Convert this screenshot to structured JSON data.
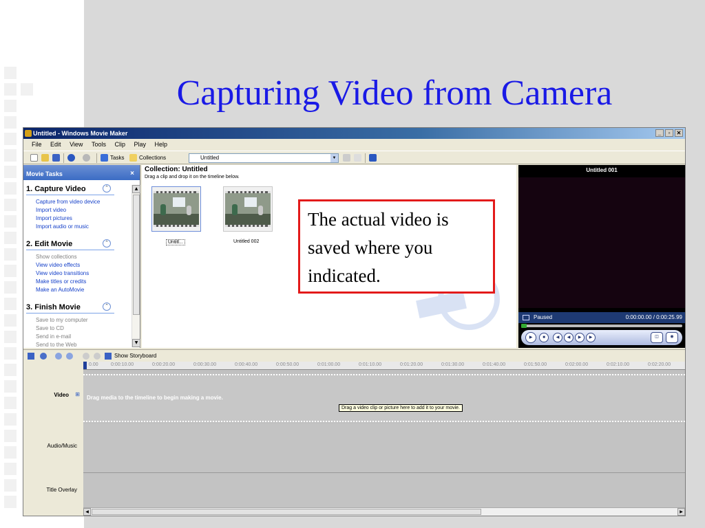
{
  "slide": {
    "title": "Capturing Video from Camera"
  },
  "window": {
    "title": "Untitled - Windows Movie Maker",
    "buttons": [
      "_",
      "▫",
      "✕"
    ]
  },
  "menu": [
    "File",
    "Edit",
    "View",
    "Tools",
    "Clip",
    "Play",
    "Help"
  ],
  "toolbar": {
    "tasks_label": "Tasks",
    "collections_label": "Collections",
    "collection_combo_value": "Untitled"
  },
  "tasks_pane": {
    "header": "Movie Tasks",
    "close": "×",
    "sections": [
      {
        "title": "1. Capture Video",
        "links": [
          "Capture from video device",
          "Import video",
          "Import pictures",
          "Import audio or music"
        ],
        "muted": false
      },
      {
        "title": "2. Edit Movie",
        "links": [
          "Show collections",
          "View video effects",
          "View video transitions",
          "Make titles or credits",
          "Make an AutoMovie"
        ],
        "muted_first": true
      },
      {
        "title": "3. Finish Movie",
        "links": [
          "Save to my computer",
          "Save to CD",
          "Send in e-mail",
          "Send to the Web"
        ],
        "muted": true
      }
    ]
  },
  "collection": {
    "title": "Collection: Untitled",
    "subtitle": "Drag a clip and drop it on the timeline below.",
    "clips": [
      {
        "label": "Untitl...",
        "selected": true
      },
      {
        "label": "Untitled 002",
        "selected": false
      }
    ]
  },
  "monitor": {
    "title": "Untitled 001",
    "state": "Paused",
    "time": "0:00:00.00 / 0:00:25.99"
  },
  "timeline_toolbar": {
    "show_storyboard": "Show Storyboard"
  },
  "timeline": {
    "ticks": [
      "0.00",
      "0:00:10.00",
      "0:00:20.00",
      "0:00:30.00",
      "0:00:40.00",
      "0:00:50.00",
      "0:01:00.00",
      "0:01:10.00",
      "0:01:20.00",
      "0:01:30.00",
      "0:01:40.00",
      "0:01:50.00",
      "0:02:00.00",
      "0:02:10.00",
      "0:02:20.00"
    ],
    "tracks": {
      "video": "Video",
      "video_expand": "⊞",
      "audio": "Audio/Music",
      "title_overlay": "Title Overlay"
    },
    "drag_hint": "Drag media to the timeline to begin making a movie.",
    "tooltip": "Drag a video clip or picture here to add it to your movie."
  },
  "callout": {
    "text": "The actual video is saved where you indicated."
  },
  "colors": {
    "title_blue": "#1a1ae6",
    "callout_border": "#e31a1a",
    "titlebar_start": "#0a246a",
    "link_blue": "#1540c9"
  }
}
